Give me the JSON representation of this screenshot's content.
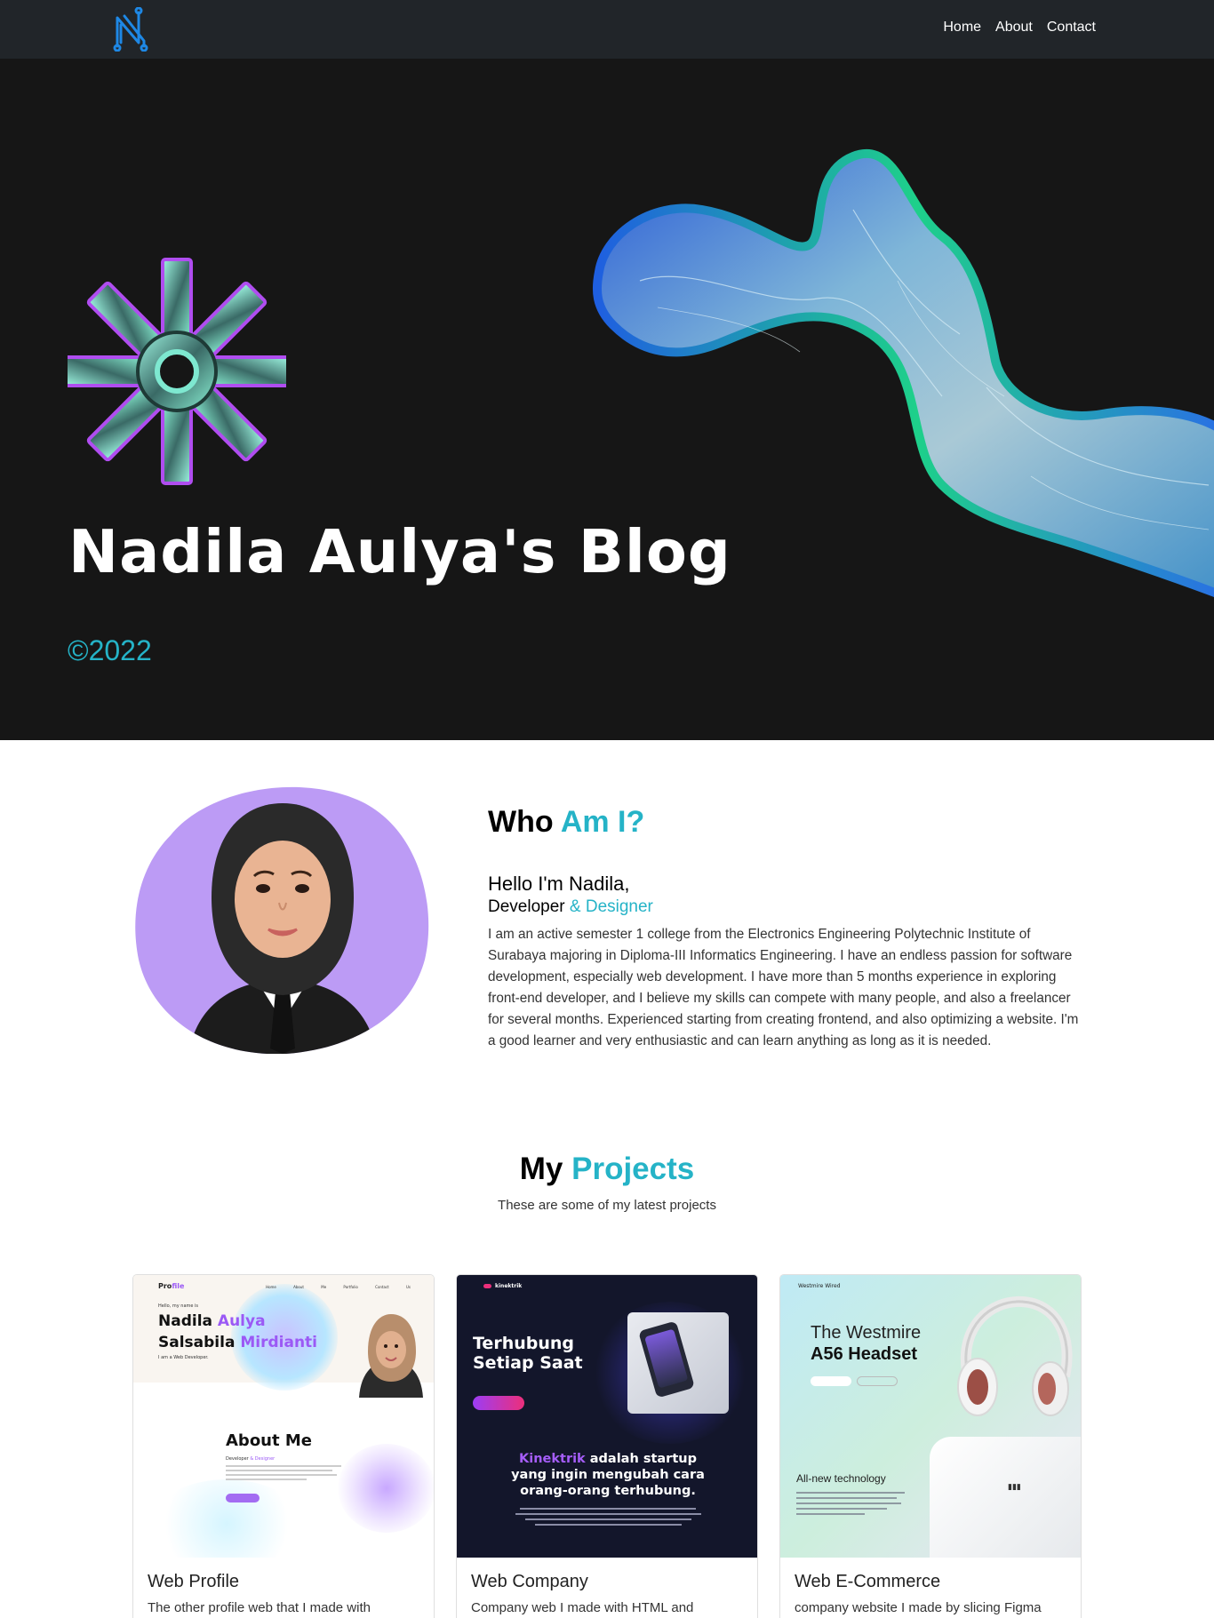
{
  "nav": {
    "links": [
      "Home",
      "About",
      "Contact"
    ]
  },
  "hero": {
    "title": "Nadila Aulya's Blog",
    "year": "©2022"
  },
  "about": {
    "title_plain": "Who",
    "title_accent": "Am I?",
    "hello": "Hello I'm Nadila,",
    "role_plain": "Developer",
    "role_accent": "& Designer",
    "description": "I am an active semester 1 college from the Electronics Engineering Polytechnic Institute of Surabaya majoring in Diploma-III Informatics Engineering. I have an endless passion for software development, especially web development. I have more than 5 months experience in exploring front-end developer, and I believe my skills can compete with many people, and also a freelancer for several months. Experienced starting from creating frontend, and also optimizing a website. I'm a good learner and very enthusiastic and can learn anything as long as it is needed."
  },
  "projects": {
    "title_plain": "My",
    "title_accent": "Projects",
    "subtitle": "These are some of my latest projects",
    "cards": [
      {
        "title": "Web Profile",
        "text": "The other profile web that I made with",
        "thumb": {
          "brand_a": "Pro",
          "brand_b": "file",
          "menu": "Home About Me Portfolio Contact Us",
          "hello": "Hello, my name is",
          "name_line1_a": "Nadila",
          "name_line1_b": "Aulya",
          "name_line2_a": "Salsabila",
          "name_line2_b": "Mirdianti",
          "sub": "I am a Web Developer.",
          "about": "About Me",
          "dev_a": "Developer",
          "dev_b": "& Designer"
        }
      },
      {
        "title": "Web Company",
        "text": "Company web I made with HTML and",
        "thumb": {
          "brand": "kinektrik",
          "heading_line1": "Terhubung",
          "heading_line2": "Setiap Saat",
          "mid_accent": "Kinektrik",
          "mid_rest_line1": "adalah startup",
          "mid_line2": "yang ingin mengubah cara",
          "mid_line3": "orang-orang terhubung."
        }
      },
      {
        "title": "Web E-Commerce",
        "text": "company website I made by slicing Figma",
        "thumb": {
          "brand": "Westmire Wired",
          "heading_line1": "The Westmire",
          "heading_line2": "A56 Headset",
          "caption": "All-new technology"
        }
      }
    ]
  },
  "colors": {
    "accent": "#25b3c7",
    "navbar": "#212529",
    "hero_bg": "#161616",
    "photo_blob": "#bc9bf5"
  }
}
